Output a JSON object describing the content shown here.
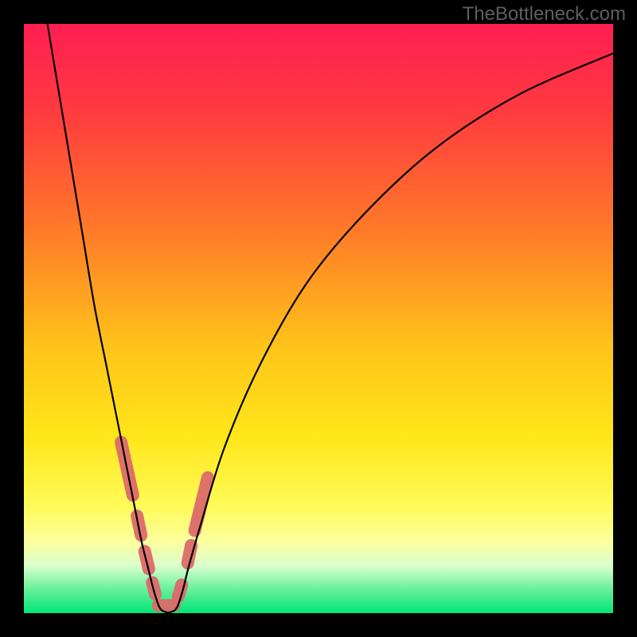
{
  "watermark": "TheBottleneck.com",
  "colors": {
    "frame": "#000000",
    "gradient_stops": [
      {
        "offset": 0.0,
        "color": "#ff1e52"
      },
      {
        "offset": 0.15,
        "color": "#ff3b3f"
      },
      {
        "offset": 0.35,
        "color": "#ff7a28"
      },
      {
        "offset": 0.55,
        "color": "#ffc41a"
      },
      {
        "offset": 0.7,
        "color": "#ffe61a"
      },
      {
        "offset": 0.82,
        "color": "#fffb5a"
      },
      {
        "offset": 0.88,
        "color": "#fbffa0"
      },
      {
        "offset": 0.92,
        "color": "#d9ffce"
      },
      {
        "offset": 0.96,
        "color": "#66f09a"
      },
      {
        "offset": 1.0,
        "color": "#00e676"
      }
    ],
    "curve": "#000000",
    "band_marker": "#dd6b6b"
  },
  "chart_data": {
    "type": "line",
    "title": "",
    "xlabel": "",
    "ylabel": "",
    "xlim": [
      0,
      100
    ],
    "ylim": [
      0,
      100
    ],
    "grid": false,
    "legend": false,
    "series": [
      {
        "name": "bottleneck-curve",
        "x": [
          4,
          6,
          8,
          10,
          12,
          14,
          16,
          18,
          19,
          20,
          21,
          22,
          23,
          24,
          25,
          26,
          27,
          28,
          30,
          34,
          40,
          48,
          58,
          70,
          84,
          100
        ],
        "y": [
          100,
          88,
          76,
          64,
          52,
          42,
          32,
          22,
          17,
          12,
          8,
          4,
          1,
          0.2,
          0.2,
          1,
          4,
          8,
          15,
          28,
          42,
          56,
          68,
          79,
          88,
          95
        ]
      }
    ],
    "curve_minimum_x": 24,
    "annotations": [
      {
        "name": "tolerance-band",
        "shape": "pill-segments",
        "color": "#dd6b6b",
        "segments": [
          {
            "x": [
              16.5,
              18.5
            ],
            "y": [
              29,
              20
            ]
          },
          {
            "x": [
              19.2,
              19.9
            ],
            "y": [
              16.5,
              13.2
            ]
          },
          {
            "x": [
              20.5,
              21.2
            ],
            "y": [
              10.5,
              7.5
            ]
          },
          {
            "x": [
              21.8,
              22.3
            ],
            "y": [
              5.2,
              3.2
            ]
          },
          {
            "x": [
              22.8,
              25.5
            ],
            "y": [
              1.3,
              1.3
            ]
          },
          {
            "x": [
              26.2,
              26.8
            ],
            "y": [
              2.8,
              4.8
            ]
          },
          {
            "x": [
              27.8,
              28.4
            ],
            "y": [
              8.5,
              11.5
            ]
          },
          {
            "x": [
              29.0,
              31.2
            ],
            "y": [
              14,
              23
            ]
          }
        ]
      }
    ]
  }
}
